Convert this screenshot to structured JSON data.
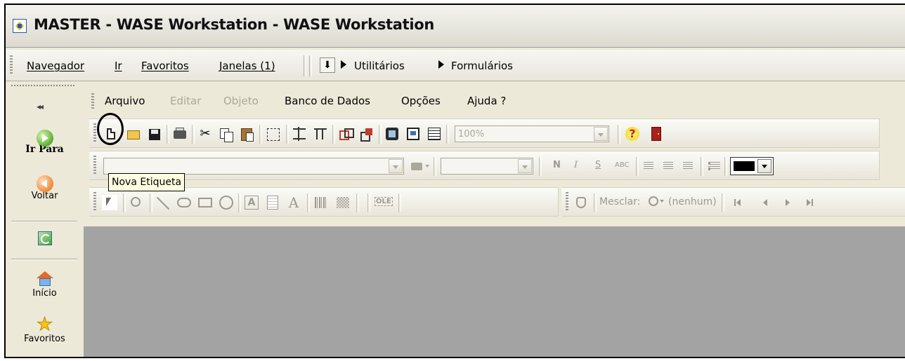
{
  "window": {
    "title": "MASTER - WASE Workstation - WASE Workstation"
  },
  "navbar": {
    "items": [
      {
        "label": "Navegador"
      },
      {
        "label": "Ir"
      },
      {
        "label": "Favoritos"
      },
      {
        "label": "Janelas (1)"
      }
    ],
    "breadcrumb": [
      "Utilitários",
      "Formulários"
    ]
  },
  "left_panel": {
    "collapse": "◂◂",
    "go_to": "Ir Para",
    "back": "Voltar",
    "home": "Início",
    "favorites": "Favoritos"
  },
  "menu": {
    "items": [
      {
        "label": "Arquivo",
        "enabled": true
      },
      {
        "label": "Editar",
        "enabled": false
      },
      {
        "label": "Objeto",
        "enabled": false
      },
      {
        "label": "Banco de Dados",
        "enabled": true
      },
      {
        "label": "Opções",
        "enabled": true
      },
      {
        "label": "Ajuda ?",
        "enabled": true
      }
    ]
  },
  "toolbar": {
    "zoom_value": "100%"
  },
  "format_toolbar": {
    "bold": "N",
    "italic": "I",
    "strike": "S",
    "abc": "ABC"
  },
  "draw_toolbar": {
    "merge_label": "Mesclar:",
    "merge_value": "(nenhum)",
    "ole_label": "OLE"
  },
  "tooltip": {
    "text": "Nova Etiqueta"
  },
  "colors": {
    "workspace": "#a3a3a3",
    "tooltip_bg": "#ffffe1",
    "chrome": "#ece9d8"
  }
}
